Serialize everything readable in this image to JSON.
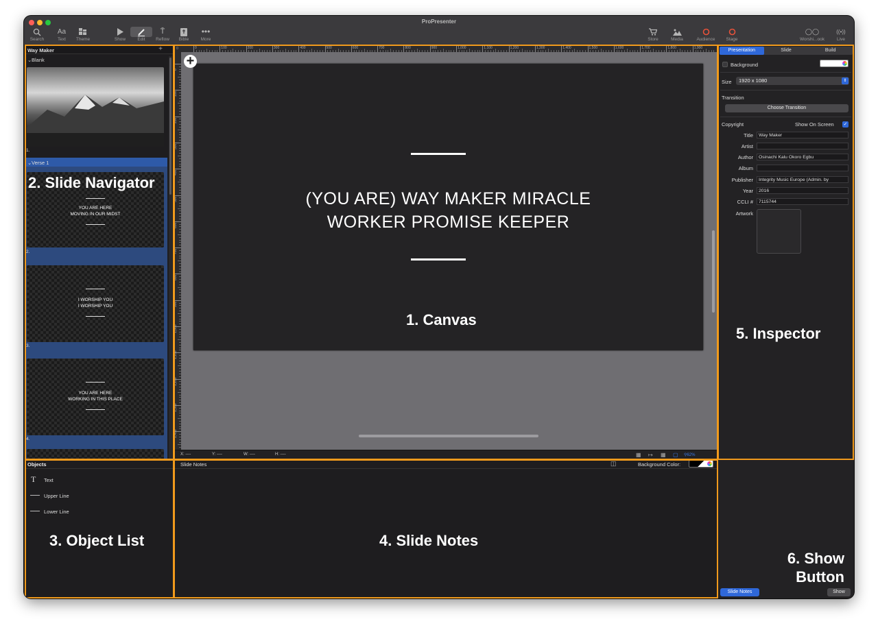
{
  "window": {
    "title": "ProPresenter"
  },
  "toolbar": {
    "items": [
      {
        "label": "Search",
        "icon": "search-icon"
      },
      {
        "label": "Text",
        "icon": "text-icon"
      },
      {
        "label": "Theme",
        "icon": "theme-icon"
      },
      {
        "label": "Show",
        "icon": "play-icon"
      },
      {
        "label": "Edit",
        "icon": "pencil-icon"
      },
      {
        "label": "Reflow",
        "icon": "reflow-icon"
      },
      {
        "label": "Bible",
        "icon": "bible-icon"
      },
      {
        "label": "More",
        "icon": "more-icon"
      },
      {
        "label": "Store",
        "icon": "store-icon"
      },
      {
        "label": "Media",
        "icon": "media-icon"
      },
      {
        "label": "Audience",
        "icon": "audience-icon"
      },
      {
        "label": "Stage",
        "icon": "stage-icon"
      },
      {
        "label": "Worshi...ook",
        "icon": "people-icon"
      },
      {
        "label": "Live",
        "icon": "live-icon"
      }
    ]
  },
  "navigator": {
    "title": "Way Maker",
    "add": "+",
    "groups": [
      {
        "label": "Blank"
      },
      {
        "label": "Verse 1"
      }
    ],
    "slides": [
      {
        "number": "1."
      },
      {
        "number": "2.",
        "text": "YOU ARE HERE\nMOVING IN OUR MIDST"
      },
      {
        "number": "3.",
        "text": "I WORSHIP YOU\nI WORSHIP YOU"
      },
      {
        "number": "4.",
        "text": "YOU ARE HERE\nWORKING IN THIS PLACE"
      }
    ]
  },
  "ruler": {
    "h_ticks": [
      "0",
      "100",
      "200",
      "300",
      "400",
      "500",
      "600",
      "700",
      "800",
      "900",
      "1,000",
      "1,100",
      "1,200",
      "1,300",
      "1,400",
      "1,500",
      "1,600",
      "1,700",
      "1,800",
      "1,900"
    ],
    "v_ticks": [
      "0",
      "100",
      "200",
      "300",
      "400",
      "500",
      "600",
      "700",
      "800",
      "900",
      "1,000",
      "1,100",
      "1,200",
      "1,300",
      "1,400"
    ]
  },
  "canvas": {
    "slide_text": "(YOU ARE) WAY MAKER MIRACLE\nWORKER PROMISE KEEPER",
    "add_icon": "+"
  },
  "status": {
    "x": "X: ----",
    "y": "Y: ----",
    "w": "W: ----",
    "h": "H: ----",
    "zoom": "62%"
  },
  "inspector": {
    "tabs": [
      {
        "label": "Presentation",
        "active": true
      },
      {
        "label": "Slide"
      },
      {
        "label": "Build"
      }
    ],
    "background_label": "Background",
    "size_label": "Size",
    "size_value": "1920 x 1080",
    "transition_label": "Transition",
    "transition_button": "Choose Transition",
    "copyright_label": "Copyright",
    "show_on_screen": "Show On Screen",
    "fields": [
      {
        "label": "Title",
        "value": "Way Maker"
      },
      {
        "label": "Artist",
        "value": ""
      },
      {
        "label": "Author",
        "value": "Osinachi Kalu Okoro Egbu"
      },
      {
        "label": "Album",
        "value": ""
      },
      {
        "label": "Publisher",
        "value": "Integrity Music Europe (Admin. by"
      },
      {
        "label": "Year",
        "value": "2016"
      },
      {
        "label": "CCLI #",
        "value": "7115744"
      }
    ],
    "artwork_label": "Artwork"
  },
  "objects": {
    "title": "Objects",
    "items": [
      {
        "label": "Text",
        "icon": "text-t-icon"
      },
      {
        "label": "Upper Line",
        "icon": "line-icon"
      },
      {
        "label": "Lower Line",
        "icon": "line-icon"
      }
    ]
  },
  "notes": {
    "title": "Slide Notes",
    "bg_label": "Background Color:"
  },
  "show_panel": {
    "notes_button": "Slide Notes",
    "show_button": "Show"
  },
  "annotations": {
    "canvas": "1. Canvas",
    "navigator": "2. Slide Navigator",
    "objects": "3. Object List",
    "notes": "4. Slide Notes",
    "inspector": "5. Inspector",
    "show": "6. Show\nButton"
  },
  "colors": {
    "annotation_border": "#f19a1c",
    "accent": "#2f68d9",
    "red_icon": "#e8523a"
  }
}
